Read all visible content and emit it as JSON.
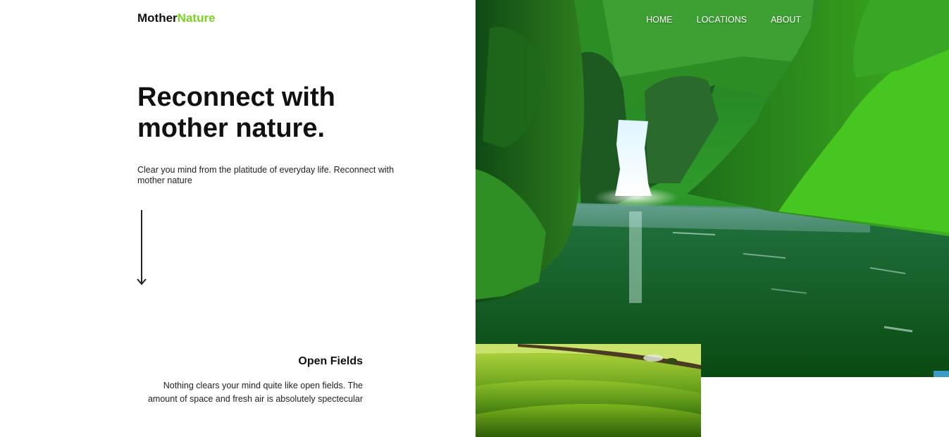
{
  "brand": {
    "name_part1": "Mother",
    "name_part2": "Nature",
    "accent_color": "#7dd321"
  },
  "nav": {
    "items": [
      {
        "label": "HOME"
      },
      {
        "label": "LOCATIONS"
      },
      {
        "label": "ABOUT"
      }
    ]
  },
  "hero": {
    "headline": "Reconnect with mother nature.",
    "subtext": "Clear you mind from the platitude of everyday life. Reconnect with mother nature",
    "scroll_icon": "arrow-down-icon",
    "image_subject": "waterfall"
  },
  "section": {
    "title": "Open Fields",
    "text": "Nothing clears your mind quite like open fields. The amount of space and fresh air is absolutely spectecular",
    "image_subject": "green-fields"
  }
}
